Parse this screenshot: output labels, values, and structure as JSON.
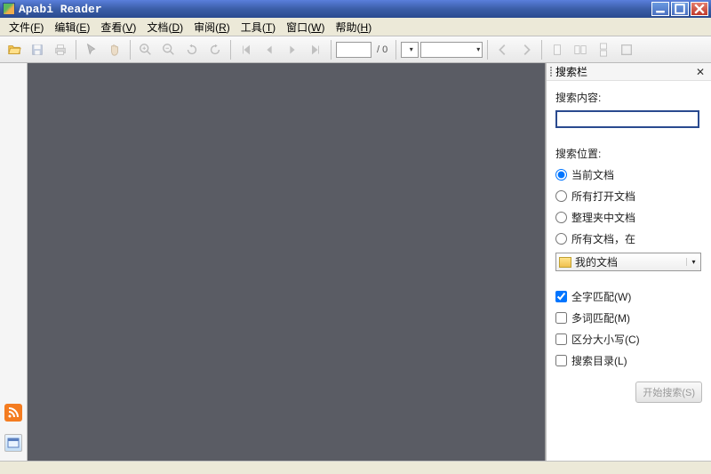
{
  "titlebar": {
    "title": "Apabi Reader"
  },
  "menubar": {
    "items": [
      {
        "label": "文件",
        "accel": "F"
      },
      {
        "label": "编辑",
        "accel": "E"
      },
      {
        "label": "查看",
        "accel": "V"
      },
      {
        "label": "文档",
        "accel": "D"
      },
      {
        "label": "审阅",
        "accel": "R"
      },
      {
        "label": "工具",
        "accel": "T"
      },
      {
        "label": "窗口",
        "accel": "W"
      },
      {
        "label": "帮助",
        "accel": "H"
      }
    ]
  },
  "toolbar": {
    "page_current": "",
    "page_total": "/ 0"
  },
  "search": {
    "panel_title": "搜索栏",
    "content_label": "搜索内容:",
    "content_value": "",
    "location_label": "搜索位置:",
    "loc_options": {
      "current": "当前文档",
      "allopen": "所有打开文档",
      "folder": "整理夹中文档",
      "all_in": "所有文档，在"
    },
    "folder_select": "我的文档",
    "opt_whole": "全字匹配(W)",
    "opt_multi": "多词匹配(M)",
    "opt_case": "区分大小写(C)",
    "opt_toc": "搜索目录(L)",
    "btn_start": "开始搜索(S)"
  }
}
